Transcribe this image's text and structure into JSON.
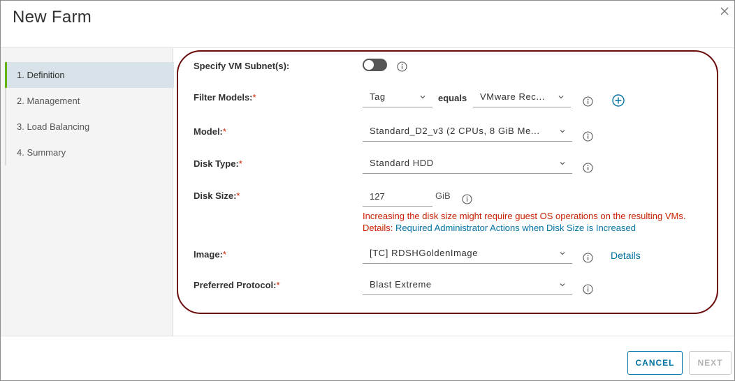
{
  "dialog": {
    "title": "New Farm"
  },
  "steps": [
    {
      "label": "1. Definition",
      "active": true
    },
    {
      "label": "2. Management",
      "active": false
    },
    {
      "label": "3. Load Balancing",
      "active": false
    },
    {
      "label": "4. Summary",
      "active": false
    }
  ],
  "form": {
    "subnet": {
      "label": "Specify VM Subnet(s):",
      "enabled": false
    },
    "filter_models": {
      "label": "Filter Models:",
      "required": "*",
      "field": "Tag",
      "operator": "equals",
      "value": "VMware Rec..."
    },
    "model": {
      "label": "Model:",
      "required": "*",
      "value": "Standard_D2_v3 (2 CPUs, 8 GiB Me..."
    },
    "disk_type": {
      "label": "Disk Type:",
      "required": "*",
      "value": "Standard HDD"
    },
    "disk_size": {
      "label": "Disk Size:",
      "required": "*",
      "value": "127",
      "unit": "GiB",
      "warning": "Increasing the disk size might require guest OS operations on the resulting VMs.",
      "details_prefix": "Details:",
      "details_link": "Required Administrator Actions when Disk Size is Increased"
    },
    "image": {
      "label": "Image:",
      "required": "*",
      "value": "[TC] RDSHGoldenImage",
      "details_link": "Details"
    },
    "protocol": {
      "label": "Preferred Protocol:",
      "required": "*",
      "value": "Blast Extreme"
    }
  },
  "footer": {
    "cancel_label": "CANCEL",
    "next_label": "NEXT"
  },
  "colors": {
    "accent": "#0072a3",
    "error": "#c92100",
    "active_step_bar": "#60b515",
    "highlight_oval": "#6b0a0a"
  },
  "icons": {
    "close": "close-icon",
    "info": "info-icon",
    "chevron": "chevron-down-icon",
    "add": "plus-circle-icon"
  }
}
